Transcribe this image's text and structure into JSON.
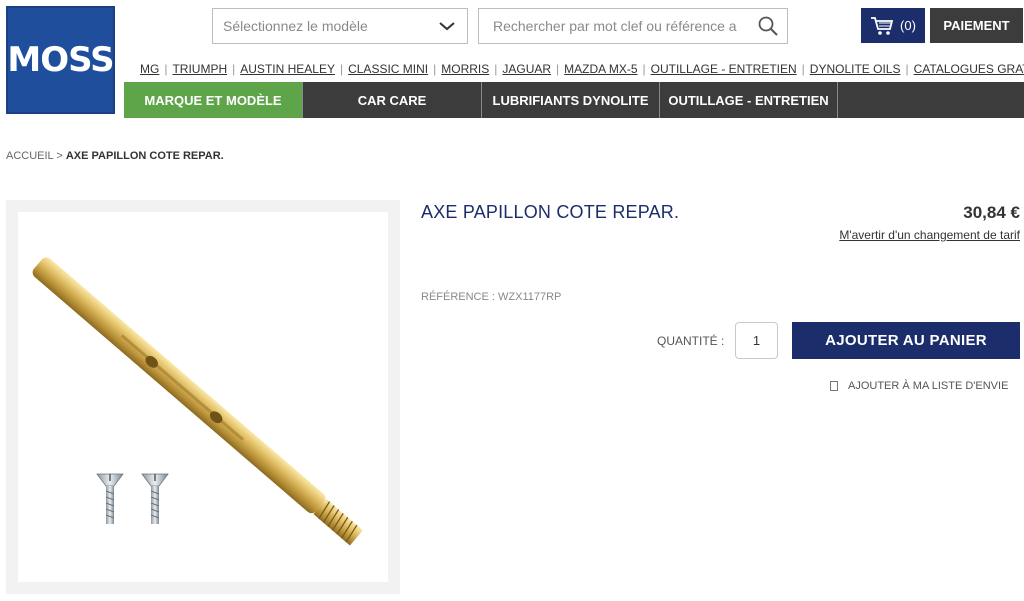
{
  "logo": {
    "text": "MOSS"
  },
  "header": {
    "model_select_placeholder": "Sélectionnez le modèle",
    "search_placeholder": "Rechercher par mot clef ou référence article",
    "cart_count": "(0)",
    "payment_label": "PAIEMENT"
  },
  "brand_links": [
    "MG",
    "TRIUMPH",
    "AUSTIN HEALEY",
    "CLASSIC MINI",
    "MORRIS",
    "JAGUAR",
    "MAZDA MX-5",
    "OUTILLAGE - ENTRETIEN",
    "DYNOLITE OILS",
    "CATALOGUES GRATUITS"
  ],
  "main_nav": [
    {
      "label": "MARQUE ET MODÈLE",
      "active": true
    },
    {
      "label": "CAR CARE",
      "active": false
    },
    {
      "label": "LUBRIFIANTS DYNOLITE",
      "active": false
    },
    {
      "label": "OUTILLAGE - ENTRETIEN",
      "active": false
    }
  ],
  "breadcrumb": {
    "home": "ACCUEIL",
    "separator": ">",
    "current": "AXE PAPILLON COTE REPAR."
  },
  "product": {
    "title": "AXE PAPILLON COTE REPAR.",
    "price": "30,84 €",
    "price_alert": "M'avertir d'un changement de tarif",
    "reference": "RÉFÉRENCE : WZX1177RP",
    "quantity_label": "QUANTITÉ :",
    "quantity_value": "1",
    "add_to_cart": "AJOUTER AU PANIER",
    "wishlist": "AJOUTER À MA LISTE D'ENVIE"
  },
  "colors": {
    "brand_blue": "#1f4f9c",
    "navy": "#1c2d6b",
    "nav_dark": "#3c3c3c",
    "nav_active": "#5ea54a",
    "brass": "#d9b45a"
  },
  "icons": {
    "dropdown": "chevron-down-icon",
    "search": "search-icon",
    "cart": "shopping-cart-icon",
    "wishlist": "checkbox-icon"
  }
}
